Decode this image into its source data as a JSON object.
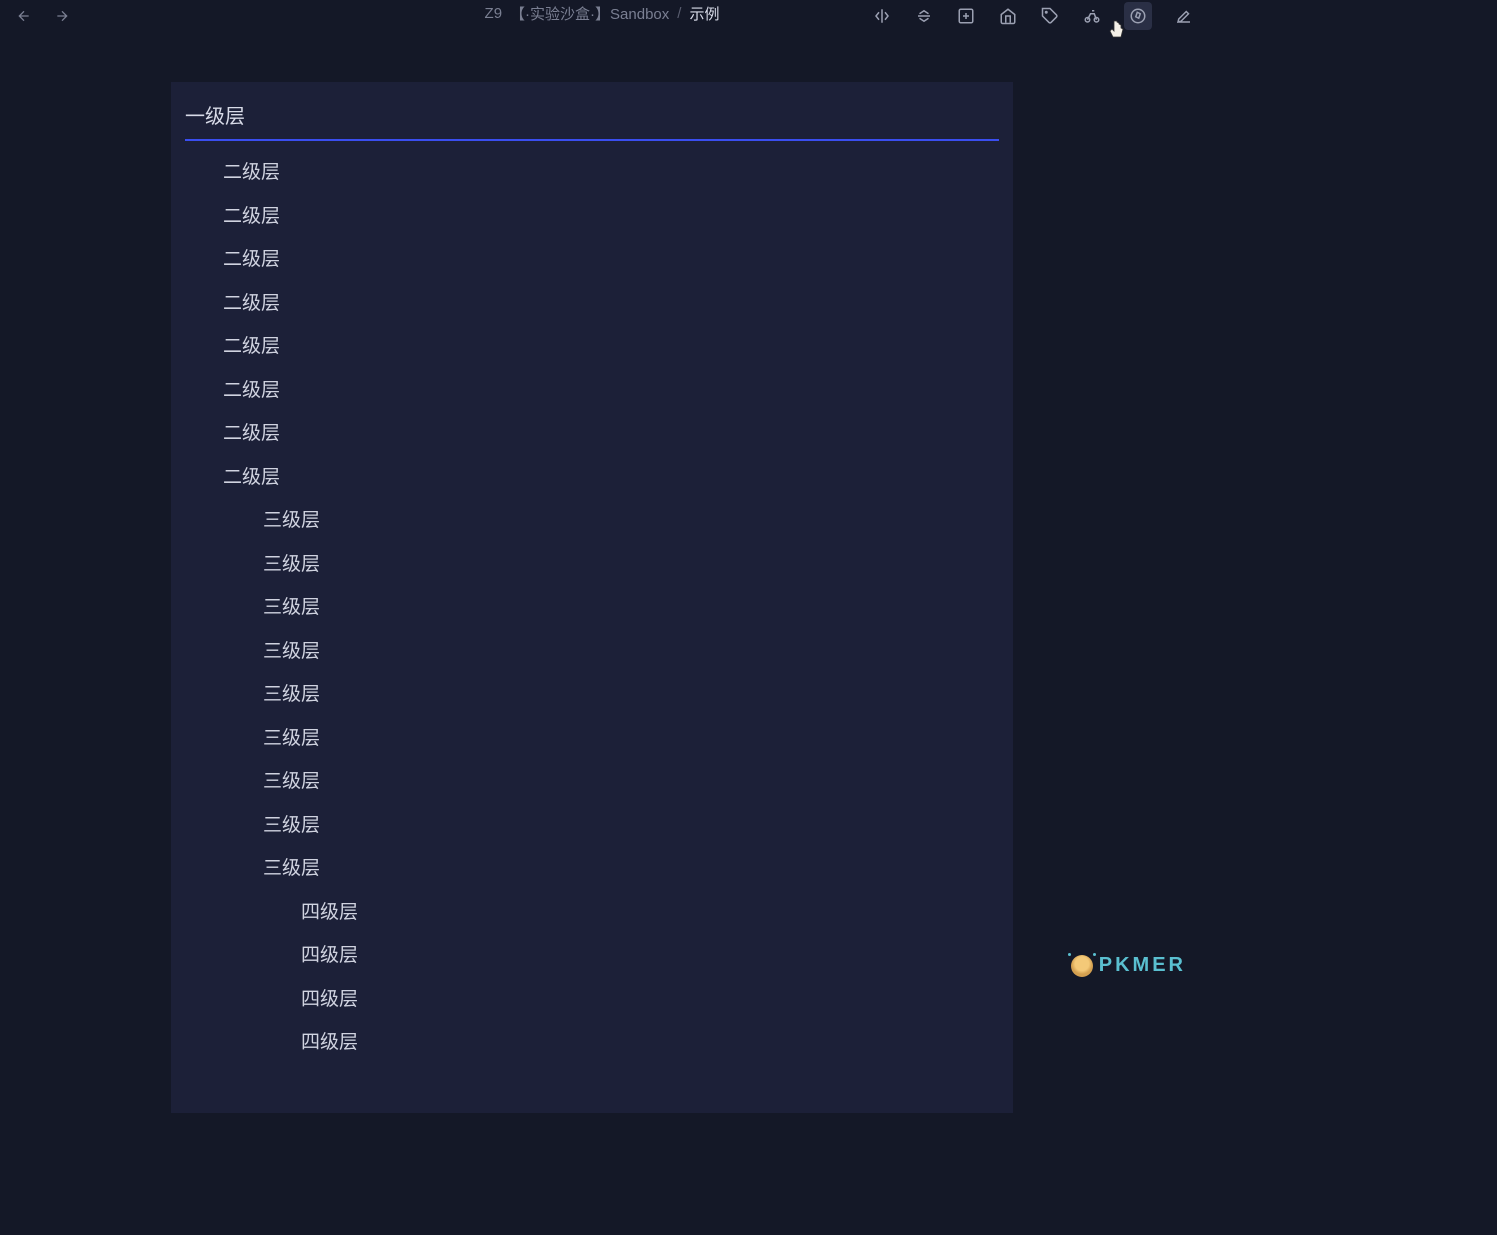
{
  "breadcrumb": {
    "seg1": "Z9",
    "seg2": "【·实验沙盒·】Sandbox",
    "sep": "/",
    "current": "示例"
  },
  "headings": {
    "level1": "一级层",
    "level2": [
      "二级层",
      "二级层",
      "二级层",
      "二级层",
      "二级层",
      "二级层",
      "二级层",
      "二级层"
    ],
    "level3": [
      "三级层",
      "三级层",
      "三级层",
      "三级层",
      "三级层",
      "三级层",
      "三级层",
      "三级层",
      "三级层"
    ],
    "level4": [
      "四级层",
      "四级层",
      "四级层",
      "四级层"
    ]
  },
  "watermark": {
    "text": "PKMER"
  },
  "icons": {
    "back": "back-icon",
    "forward": "forward-icon",
    "split": "split-icon",
    "collapse": "collapse-icon",
    "add": "add-icon",
    "home": "home-icon",
    "tag": "tag-icon",
    "bike": "bike-icon",
    "compass": "compass-icon",
    "edit": "edit-icon"
  }
}
